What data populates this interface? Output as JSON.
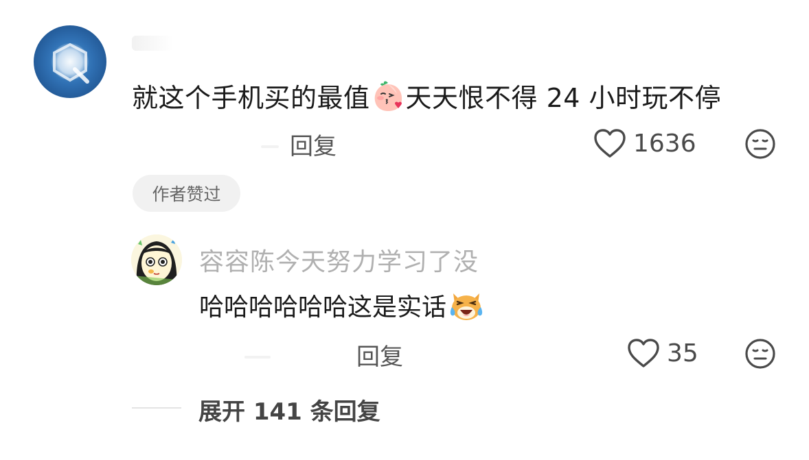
{
  "comment": {
    "text_before_emoji": "就这个手机买的最值",
    "text_after_emoji": "天天恨不得 24 小时玩不停",
    "emoji": "peach-kiss-emoji",
    "reply_label": "回复",
    "like_count": "1636",
    "author_liked_tag": "作者赞过"
  },
  "reply": {
    "username": "容容陈今天努力学习了没",
    "text": "哈哈哈哈哈哈这是实话",
    "emoji": "laughing-cat-emoji",
    "reply_label": "回复",
    "like_count": "35"
  },
  "expand": {
    "label": "展开 141 条回复"
  },
  "colors": {
    "text_primary": "#1a1a1a",
    "text_secondary": "#555555",
    "username_gray": "#b0b0b0",
    "tag_bg": "#f1f1f1",
    "avatar_blue": "#2f6fb2"
  }
}
